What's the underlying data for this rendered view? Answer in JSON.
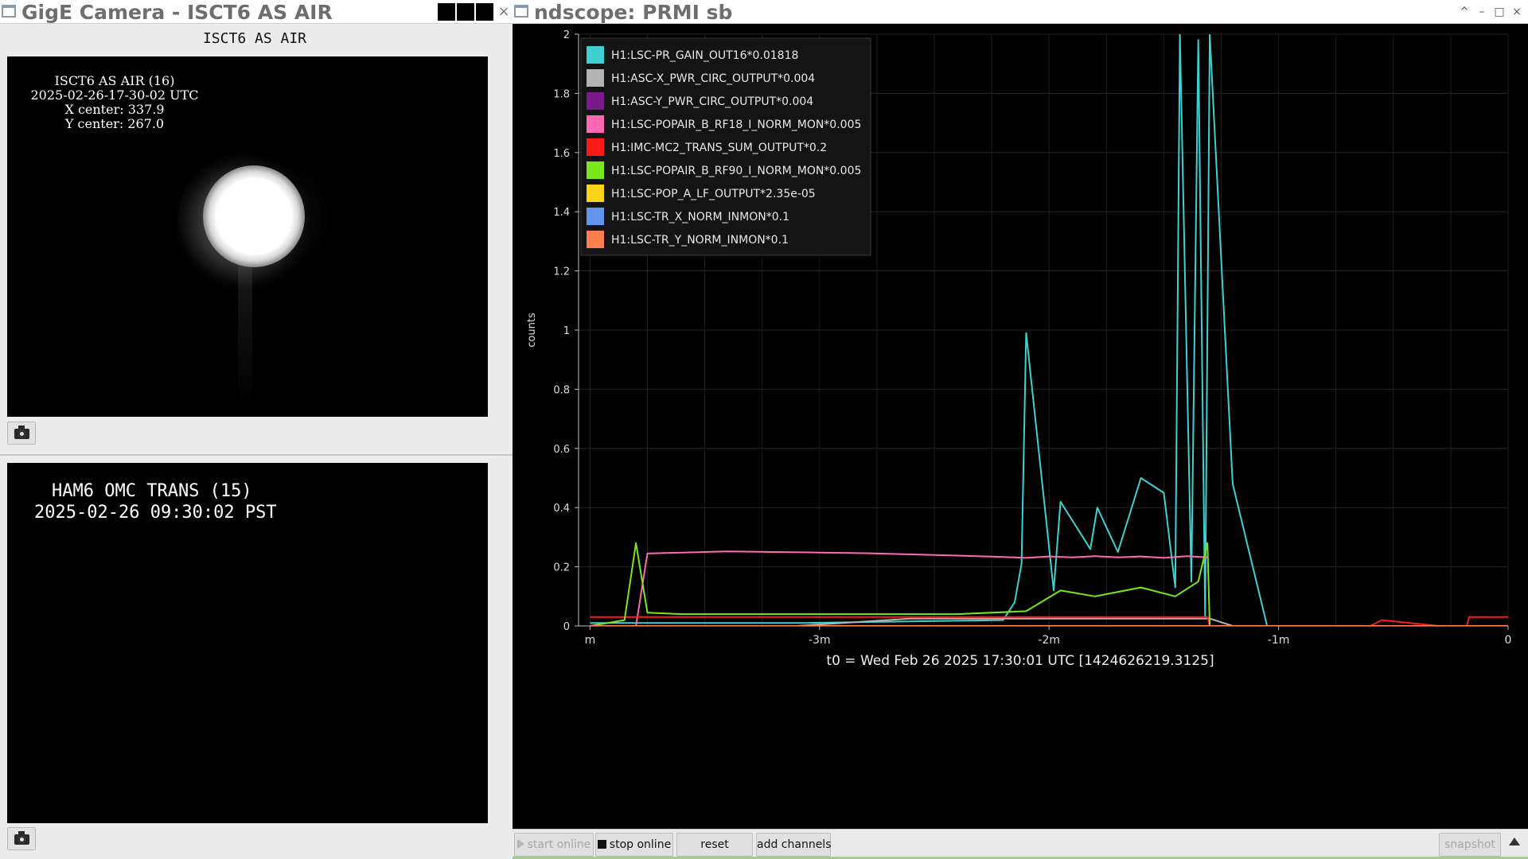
{
  "camera_window": {
    "title": "GigE Camera - ISCT6 AS AIR",
    "close_glyph": "×",
    "cam1": {
      "caption": "ISCT6 AS AIR",
      "overlay_lines": [
        "ISCT6 AS AIR (16)",
        "2025-02-26-17-30-02 UTC",
        "X center: 337.9",
        "Y center: 267.0"
      ],
      "snapshot_icon": "camera-icon"
    },
    "cam2": {
      "overlay_lines": [
        "HAM6 OMC TRANS (15)",
        "2025-02-26 09:30:02 PST"
      ],
      "snapshot_icon": "camera-icon"
    }
  },
  "scope_window": {
    "title": "ndscope: PRMI sb",
    "controls": {
      "maximize": "^",
      "minimize": "–",
      "restore": "□",
      "close": "×"
    },
    "plot": {
      "t0_label": "t0 = Wed Feb 26 2025 17:30:01 UTC [1424626219.3125]"
    },
    "toolbar": {
      "start_online": "start online",
      "stop_online": "stop online",
      "reset": "reset",
      "add_channels": "add channels",
      "snapshot": "snapshot"
    }
  },
  "chart_data": {
    "type": "line",
    "title": "",
    "xlabel": "",
    "ylabel": "counts",
    "xlim": [
      -4.05,
      0
    ],
    "ylim": [
      0,
      2
    ],
    "x_ticks": [
      {
        "value": -4,
        "label": "m"
      },
      {
        "value": -3,
        "label": "-3m"
      },
      {
        "value": -2,
        "label": "-2m"
      },
      {
        "value": -1,
        "label": "-1m"
      },
      {
        "value": 0,
        "label": "0"
      }
    ],
    "y_ticks": [
      {
        "value": 0,
        "label": "0"
      },
      {
        "value": 0.2,
        "label": "0.2"
      },
      {
        "value": 0.4,
        "label": "0.4"
      },
      {
        "value": 0.6,
        "label": "0.6"
      },
      {
        "value": 0.8,
        "label": "0.8"
      },
      {
        "value": 1,
        "label": "1"
      },
      {
        "value": 1.2,
        "label": "1.2"
      },
      {
        "value": 1.4,
        "label": "1.4"
      },
      {
        "value": 1.6,
        "label": "1.6"
      },
      {
        "value": 1.8,
        "label": "1.8"
      },
      {
        "value": 2,
        "label": "2"
      }
    ],
    "grid": true,
    "legend_position": "top-left",
    "series": [
      {
        "name": "H1:LSC-PR_GAIN_OUT16*0.01818",
        "color": "#40d0d0",
        "x": [
          -4.0,
          -3.1,
          -2.2,
          -2.15,
          -2.12,
          -2.1,
          -1.98,
          -1.95,
          -1.82,
          -1.79,
          -1.7,
          -1.6,
          -1.5,
          -1.45,
          -1.43,
          -1.38,
          -1.35,
          -1.32,
          -1.3,
          -1.2,
          -1.05,
          -0.9,
          -0.5,
          -0.1,
          0.0
        ],
        "y": [
          0.01,
          0.01,
          0.02,
          0.08,
          0.21,
          0.99,
          0.12,
          0.42,
          0.26,
          0.4,
          0.25,
          0.5,
          0.45,
          0.13,
          2.0,
          0.15,
          1.98,
          0.03,
          2.0,
          0.48,
          0.0,
          0.0,
          0.0,
          0.0,
          0.0
        ]
      },
      {
        "name": "H1:ASC-X_PWR_CIRC_OUTPUT*0.004",
        "color": "#b4b4b4",
        "x": [
          -4.0,
          -3.1,
          -2.6,
          -1.3,
          -1.2,
          0.0
        ],
        "y": [
          0.0,
          0.0,
          0.025,
          0.025,
          0.0,
          0.0
        ]
      },
      {
        "name": "H1:ASC-Y_PWR_CIRC_OUTPUT*0.004",
        "color": "#7a1a8a",
        "x": [
          -4.0,
          -1.3,
          -1.2,
          0.0
        ],
        "y": [
          0.0,
          0.0,
          0.0,
          0.0
        ]
      },
      {
        "name": "H1:LSC-POPAIR_B_RF18_I_NORM_MON*0.005",
        "color": "#ff69b4",
        "x": [
          -3.8,
          -3.75,
          -3.6,
          -3.4,
          -3.2,
          -3.0,
          -2.8,
          -2.6,
          -2.4,
          -2.2,
          -2.1,
          -2.0,
          -1.9,
          -1.8,
          -1.7,
          -1.6,
          -1.5,
          -1.4,
          -1.31
        ],
        "y": [
          0.0,
          0.245,
          0.248,
          0.252,
          0.25,
          0.248,
          0.246,
          0.242,
          0.238,
          0.233,
          0.23,
          0.235,
          0.232,
          0.236,
          0.232,
          0.235,
          0.23,
          0.236,
          0.232
        ]
      },
      {
        "name": "H1:IMC-MC2_TRANS_SUM_OUTPUT*0.2",
        "color": "#ff1a1a",
        "x": [
          -4.0,
          -3.5,
          -3.0,
          -2.5,
          -2.0,
          -1.5,
          -1.31,
          -1.3,
          -0.6,
          -0.55,
          -0.3,
          -0.18,
          -0.17,
          0.0
        ],
        "y": [
          0.03,
          0.03,
          0.03,
          0.03,
          0.03,
          0.03,
          0.03,
          0.0,
          0.0,
          0.02,
          0.0,
          0.0,
          0.03,
          0.03
        ]
      },
      {
        "name": "H1:LSC-POPAIR_B_RF90_I_NORM_MON*0.005",
        "color": "#7ae61e",
        "x": [
          -4.0,
          -3.85,
          -3.8,
          -3.75,
          -3.6,
          -3.2,
          -2.8,
          -2.4,
          -2.1,
          -1.95,
          -1.8,
          -1.6,
          -1.45,
          -1.35,
          -1.31,
          -1.3,
          0.0
        ],
        "y": [
          0.0,
          0.02,
          0.28,
          0.045,
          0.04,
          0.04,
          0.04,
          0.04,
          0.05,
          0.12,
          0.1,
          0.13,
          0.1,
          0.15,
          0.28,
          0.0,
          0.0
        ]
      },
      {
        "name": "H1:LSC-POP_A_LF_OUTPUT*2.35e-05",
        "color": "#ffd21a",
        "x": [
          -4.0,
          0.0
        ],
        "y": [
          0.0,
          0.0
        ]
      },
      {
        "name": "H1:LSC-TR_X_NORM_INMON*0.1",
        "color": "#6495ed",
        "x": [
          -4.0,
          0.0
        ],
        "y": [
          0.0,
          0.0
        ]
      },
      {
        "name": "H1:LSC-TR_Y_NORM_INMON*0.1",
        "color": "#ff7f50",
        "x": [
          -4.0,
          0.0
        ],
        "y": [
          0.0,
          0.0
        ]
      }
    ]
  }
}
